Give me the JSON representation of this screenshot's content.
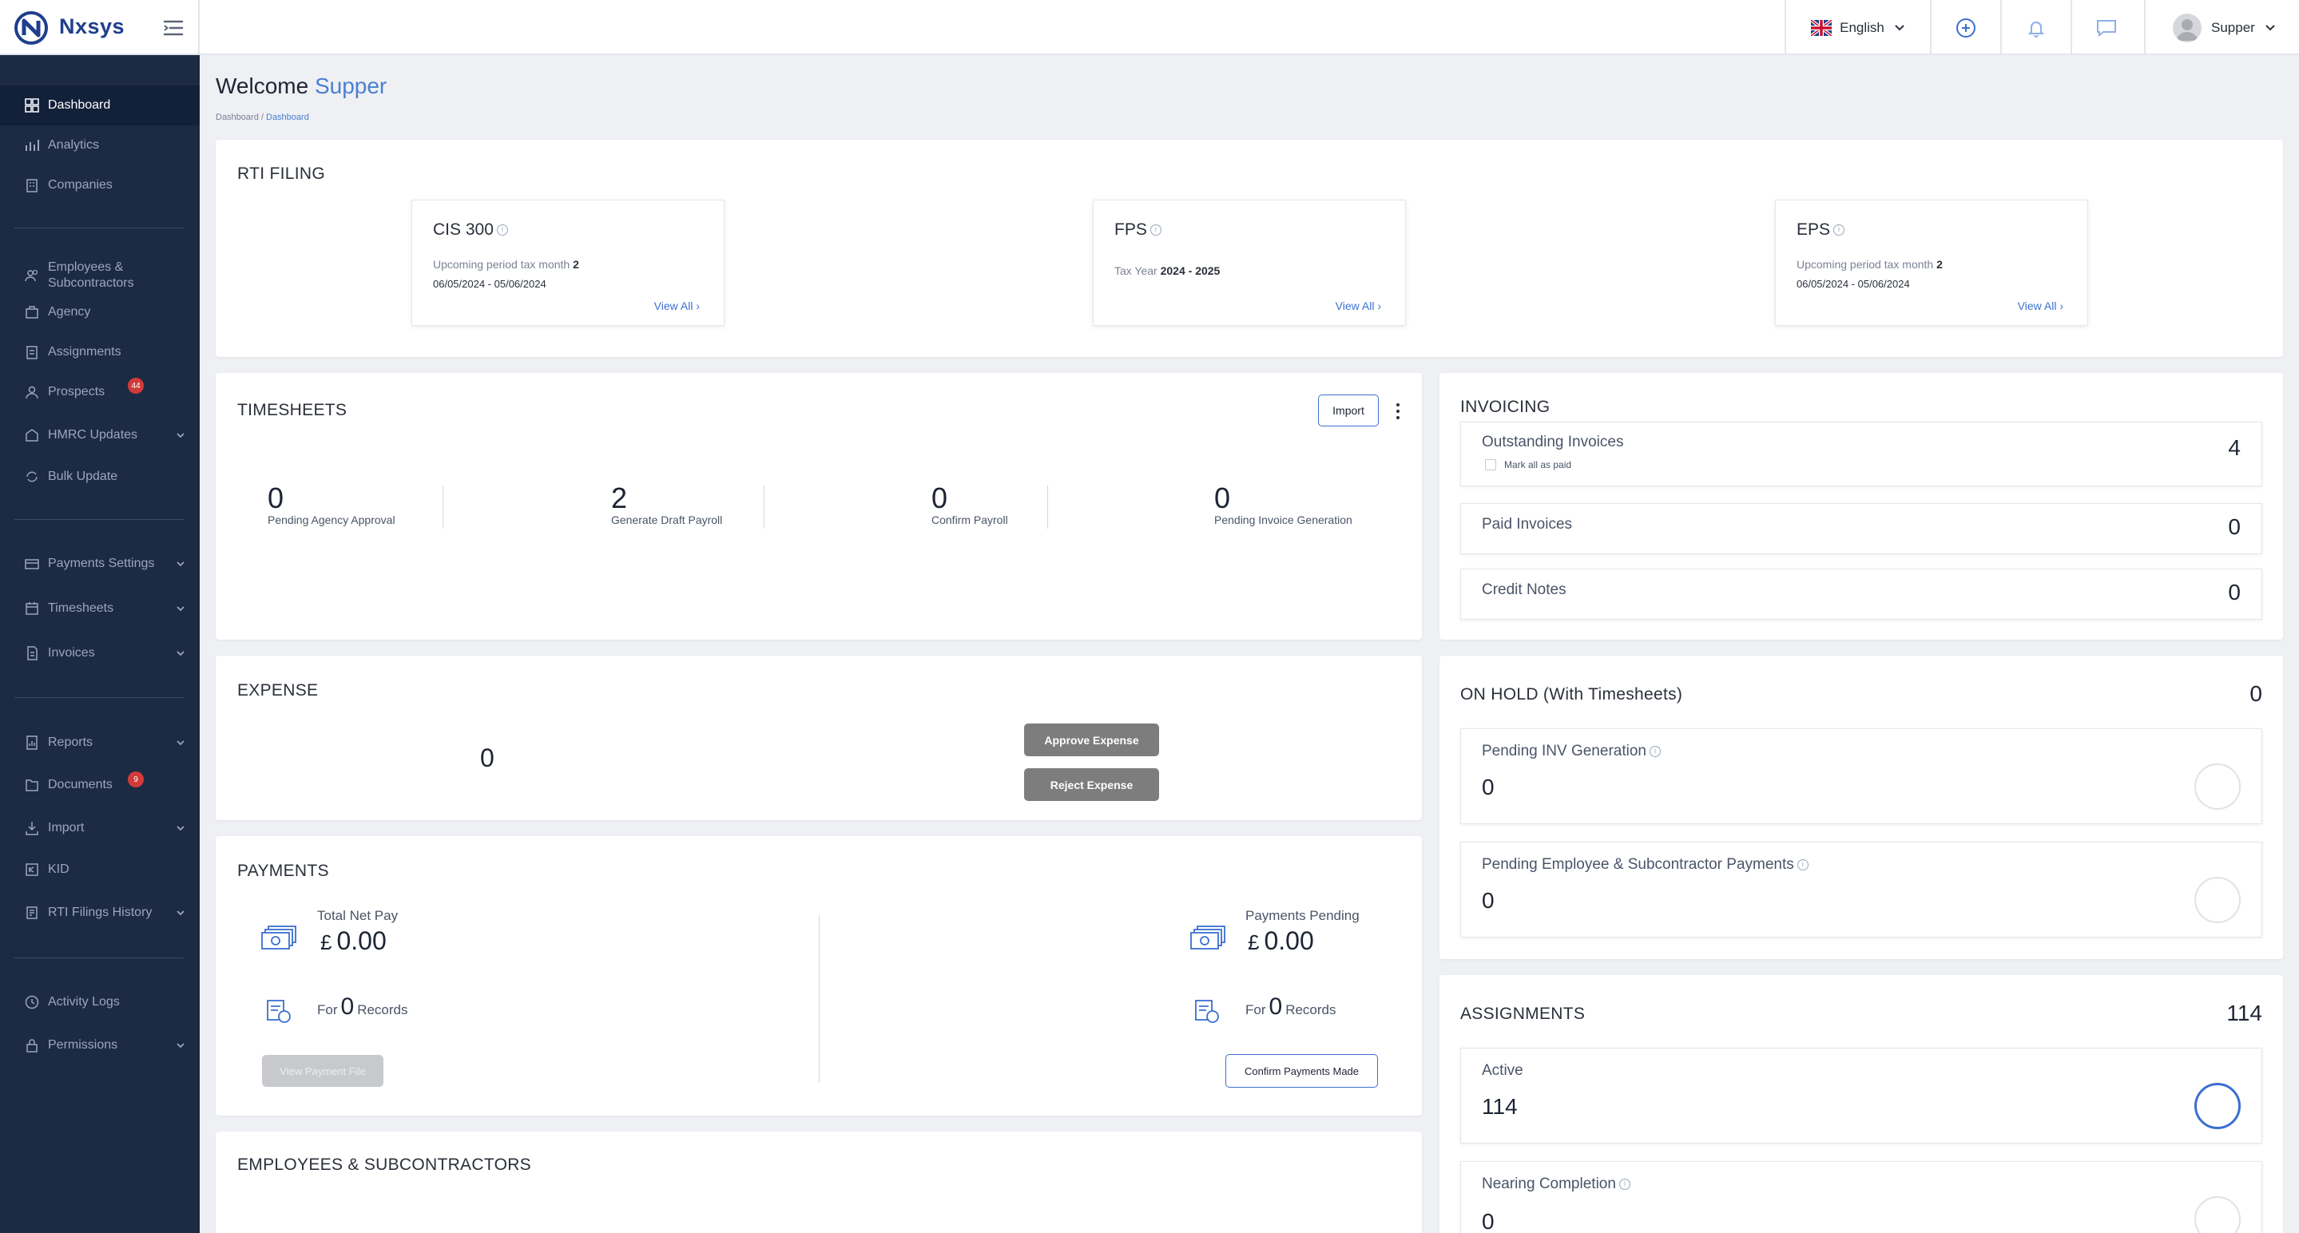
{
  "app": {
    "name": "Nxsys"
  },
  "topbar": {
    "language": "English",
    "user_name": "Supper"
  },
  "sidebar": {
    "items": [
      {
        "label": "Dashboard"
      },
      {
        "label": "Analytics"
      },
      {
        "label": "Companies"
      },
      {
        "label_line1": "Employees &",
        "label_line2": "Subcontractors"
      },
      {
        "label": "Agency"
      },
      {
        "label": "Assignments"
      },
      {
        "label": "Prospects",
        "badge": "44"
      },
      {
        "label": "HMRC Updates"
      },
      {
        "label": "Bulk Update"
      },
      {
        "label": "Payments Settings"
      },
      {
        "label": "Timesheets"
      },
      {
        "label": "Invoices"
      },
      {
        "label": "Reports"
      },
      {
        "label": "Documents",
        "badge": "9"
      },
      {
        "label": "Import"
      },
      {
        "label": "KID"
      },
      {
        "label": "RTI Filings History"
      },
      {
        "label": "Activity Logs"
      },
      {
        "label": "Permissions"
      }
    ]
  },
  "header": {
    "welcome": "Welcome",
    "user": "Supper",
    "breadcrumb_root": "Dashboard",
    "breadcrumb_sep": " / ",
    "breadcrumb_current": "Dashboard"
  },
  "rti": {
    "title": "RTI FILING",
    "cis": {
      "title": "CIS 300",
      "sub_label": "Upcoming period tax month",
      "sub_value": "2",
      "dates": "06/05/2024 - 05/06/2024",
      "link": "View All"
    },
    "fps": {
      "title": "FPS",
      "sub_label": "Tax Year",
      "sub_value": "2024 - 2025",
      "link": "View All"
    },
    "eps": {
      "title": "EPS",
      "sub_label": "Upcoming period tax month",
      "sub_value": "2",
      "dates": "06/05/2024 - 05/06/2024",
      "link": "View All"
    }
  },
  "timesheets": {
    "title": "TIMESHEETS",
    "import_label": "Import",
    "stats": [
      {
        "value": "0",
        "label": "Pending Agency Approval"
      },
      {
        "value": "2",
        "label": "Generate Draft Payroll"
      },
      {
        "value": "0",
        "label": "Confirm Payroll"
      },
      {
        "value": "0",
        "label": "Pending Invoice Generation"
      }
    ]
  },
  "expense": {
    "title": "EXPENSE",
    "value": "0",
    "approve_label": "Approve Expense",
    "reject_label": "Reject Expense"
  },
  "payments": {
    "title": "PAYMENTS",
    "net_label": "Total Net Pay",
    "net_currency": "£",
    "net_value": "0.00",
    "net_for": "For",
    "net_records_count": "0",
    "net_records": "Records",
    "view_file_label": "View Payment File",
    "pending_label": "Payments Pending",
    "pending_currency": "£",
    "pending_value": "0.00",
    "pending_for": "For",
    "pending_records_count": "0",
    "pending_records": "Records",
    "confirm_label": "Confirm Payments Made"
  },
  "employees": {
    "title": "EMPLOYEES & SUBCONTRACTORS"
  },
  "invoicing": {
    "title": "INVOICING",
    "outstanding_label": "Outstanding Invoices",
    "outstanding_value": "4",
    "mark_all_label": "Mark all as paid",
    "paid_label": "Paid Invoices",
    "paid_value": "0",
    "credit_label": "Credit Notes",
    "credit_value": "0"
  },
  "on_hold": {
    "title": "ON HOLD (With Timesheets)",
    "total": "0",
    "pending_inv_label": "Pending INV Generation",
    "pending_inv_value": "0",
    "pending_emp_label": "Pending Employee & Subcontractor Payments",
    "pending_emp_value": "0"
  },
  "assignments": {
    "title": "ASSIGNMENTS",
    "total": "114",
    "active_label": "Active",
    "active_value": "114",
    "nearing_label": "Nearing Completion",
    "nearing_value": "0"
  },
  "colors": {
    "sidebar_bg": "#1c2a44",
    "accent": "#3b6fd0",
    "badge": "#d33a3a"
  }
}
